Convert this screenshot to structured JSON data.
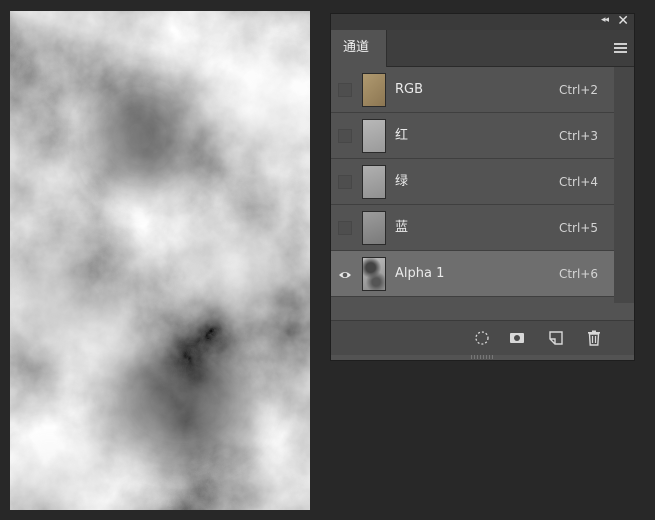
{
  "panel": {
    "tab_label": "通道",
    "icons": {
      "collapse": "double-chevron-left-icon",
      "close": "close-icon",
      "menu": "hamburger-menu-icon"
    }
  },
  "channels": [
    {
      "label": "RGB",
      "shortcut": "Ctrl+2",
      "visible": false,
      "selected": false,
      "thumb_color": "#a08a62"
    },
    {
      "label": "红",
      "shortcut": "Ctrl+3",
      "visible": false,
      "selected": false,
      "thumb_color": "#a9a9a9"
    },
    {
      "label": "绿",
      "shortcut": "Ctrl+4",
      "visible": false,
      "selected": false,
      "thumb_color": "#a2a2a2"
    },
    {
      "label": "蓝",
      "shortcut": "Ctrl+5",
      "visible": false,
      "selected": false,
      "thumb_color": "#8e8e8e"
    },
    {
      "label": "Alpha 1",
      "shortcut": "Ctrl+6",
      "visible": true,
      "selected": true,
      "thumb_color": "#9a9a9a"
    }
  ],
  "footer_icons": [
    "load-selection-icon",
    "save-selection-as-channel-icon",
    "new-channel-icon",
    "trash-icon"
  ],
  "colors": {
    "panel_bg": "#535353",
    "selected_row": "#6e6e6e",
    "app_bg": "#282828"
  }
}
